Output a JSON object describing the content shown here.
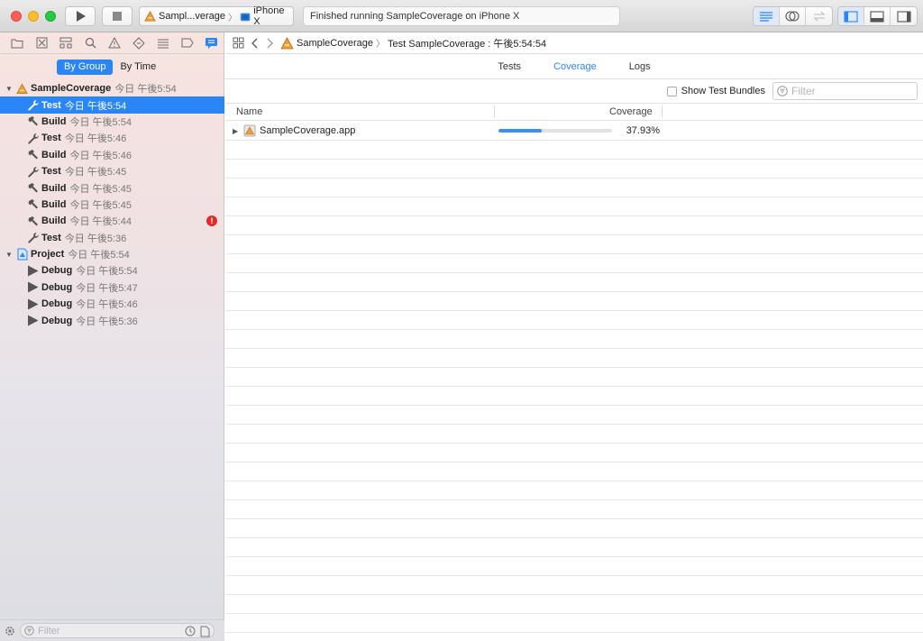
{
  "toolbar": {
    "scheme_name": "Sampl...verage",
    "scheme_separator": "〉",
    "destination": "iPhone X",
    "activity_status": "Finished running SampleCoverage on iPhone X"
  },
  "navigator": {
    "group_seg": {
      "by_group": "By Group",
      "by_time": "By Time",
      "selected": "By Group"
    },
    "tree": [
      {
        "type": "group",
        "name": "SampleCoverage",
        "time": "今日 午後5:54",
        "icon": "app-icon"
      },
      {
        "type": "item",
        "name": "Test",
        "time": "今日 午後5:54",
        "icon": "wrench-icon",
        "selected": true
      },
      {
        "type": "item",
        "name": "Build",
        "time": "今日 午後5:54",
        "icon": "hammer-icon"
      },
      {
        "type": "item",
        "name": "Test",
        "time": "今日 午後5:46",
        "icon": "wrench-icon"
      },
      {
        "type": "item",
        "name": "Build",
        "time": "今日 午後5:46",
        "icon": "hammer-icon"
      },
      {
        "type": "item",
        "name": "Test",
        "time": "今日 午後5:45",
        "icon": "wrench-icon"
      },
      {
        "type": "item",
        "name": "Build",
        "time": "今日 午後5:45",
        "icon": "hammer-icon"
      },
      {
        "type": "item",
        "name": "Build",
        "time": "今日 午後5:45",
        "icon": "hammer-icon"
      },
      {
        "type": "item",
        "name": "Build",
        "time": "今日 午後5:44",
        "icon": "hammer-icon",
        "error": "!"
      },
      {
        "type": "item",
        "name": "Test",
        "time": "今日 午後5:36",
        "icon": "wrench-icon"
      },
      {
        "type": "group",
        "name": "Project",
        "time": "今日 午後5:54",
        "icon": "project-icon"
      },
      {
        "type": "item",
        "name": "Debug",
        "time": "今日 午後5:54",
        "icon": "play-icon"
      },
      {
        "type": "item",
        "name": "Debug",
        "time": "今日 午後5:47",
        "icon": "play-icon"
      },
      {
        "type": "item",
        "name": "Debug",
        "time": "今日 午後5:46",
        "icon": "play-icon"
      },
      {
        "type": "item",
        "name": "Debug",
        "time": "今日 午後5:36",
        "icon": "play-icon"
      }
    ],
    "filter_placeholder": "Filter"
  },
  "jumpbar": {
    "project": "SampleCoverage",
    "separator": "〉",
    "report": "Test SampleCoverage : 午後5:54:54"
  },
  "tabs": [
    {
      "label": "Tests",
      "selected": false
    },
    {
      "label": "Coverage",
      "selected": true
    },
    {
      "label": "Logs",
      "selected": false
    }
  ],
  "filterbar": {
    "show_test_bundles": "Show Test Bundles",
    "filter_placeholder": "Filter"
  },
  "table": {
    "columns": {
      "name": "Name",
      "coverage": "Coverage"
    },
    "rows": [
      {
        "name": "SampleCoverage.app",
        "coverage_label": "37.93%",
        "coverage": 0.3793
      }
    ]
  },
  "colors": {
    "accent": "#2a86f6",
    "coverage_bar": "#3b8ef5",
    "error": "#e02b2b"
  }
}
